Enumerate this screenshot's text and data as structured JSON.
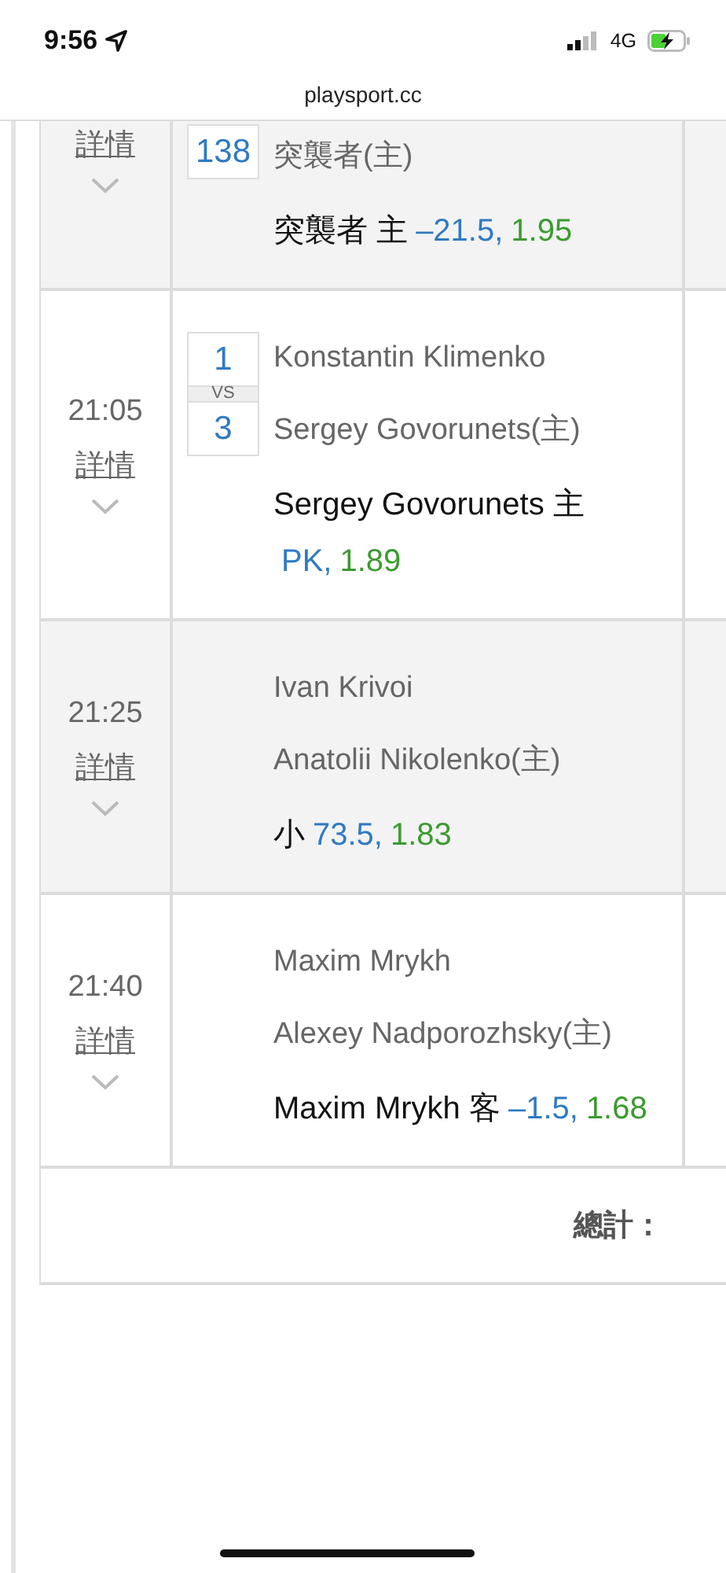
{
  "status_bar": {
    "time": "9:56",
    "network": "4G"
  },
  "address_bar": {
    "url": "playsport.cc"
  },
  "rows": [
    {
      "detail": "詳情",
      "score": [
        "138"
      ],
      "teams": [
        "突襲者(主)"
      ],
      "pick": {
        "label": "突襲者 主",
        "line": "–21.5,",
        "odds": "1.95"
      }
    },
    {
      "time": "21:05",
      "detail": "詳情",
      "score": [
        "1",
        "3"
      ],
      "vs": "VS",
      "teams": [
        "Konstantin Klimenko",
        "Sergey Govorunets(主)"
      ],
      "pick": {
        "label": "Sergey Govorunets 主",
        "line": "PK,",
        "odds": "1.89"
      }
    },
    {
      "time": "21:25",
      "detail": "詳情",
      "teams": [
        "Ivan Krivoi",
        "Anatolii Nikolenko(主)"
      ],
      "pick": {
        "label": "小",
        "line": "73.5,",
        "odds": "1.83"
      }
    },
    {
      "time": "21:40",
      "detail": "詳情",
      "teams": [
        "Maxim Mrykh",
        "Alexey Nadporozhsky(主)"
      ],
      "pick": {
        "label": "Maxim Mrykh 客",
        "line": "–1.5,",
        "odds": "1.68"
      }
    }
  ],
  "total": {
    "label": "總計："
  }
}
